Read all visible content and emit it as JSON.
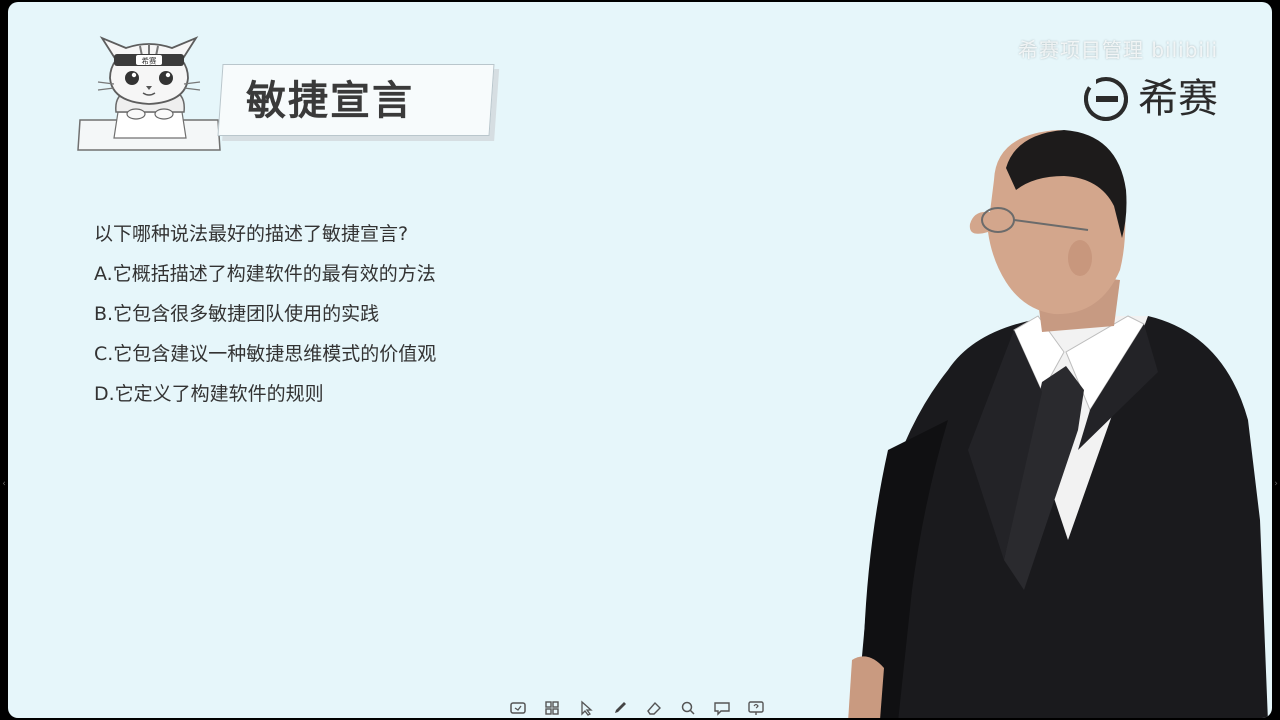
{
  "slide": {
    "title": "敏捷宣言",
    "mascot_headband_text": "希赛",
    "brand_name": "希赛",
    "watermark": "希赛项目管理 bilibili"
  },
  "question": {
    "prompt": "以下哪种说法最好的描述了敏捷宣言?",
    "options": [
      "A.它概括描述了构建软件的最有效的方法",
      "B.它包含很多敏捷团队使用的实践",
      "C.它包含建议一种敏捷思维模式的价值观",
      "D.它定义了构建软件的规则"
    ]
  },
  "toolbar": {
    "icons": [
      "screen-icon",
      "grid-icon",
      "pointer-icon",
      "pen-icon",
      "eraser-icon",
      "search-icon",
      "comment-icon",
      "help-screen-icon"
    ]
  },
  "colors": {
    "slide_bg": "#e6f6fa",
    "title_text": "#3a3a3a",
    "body_text": "#333333",
    "suit": "#1a1a1d"
  }
}
